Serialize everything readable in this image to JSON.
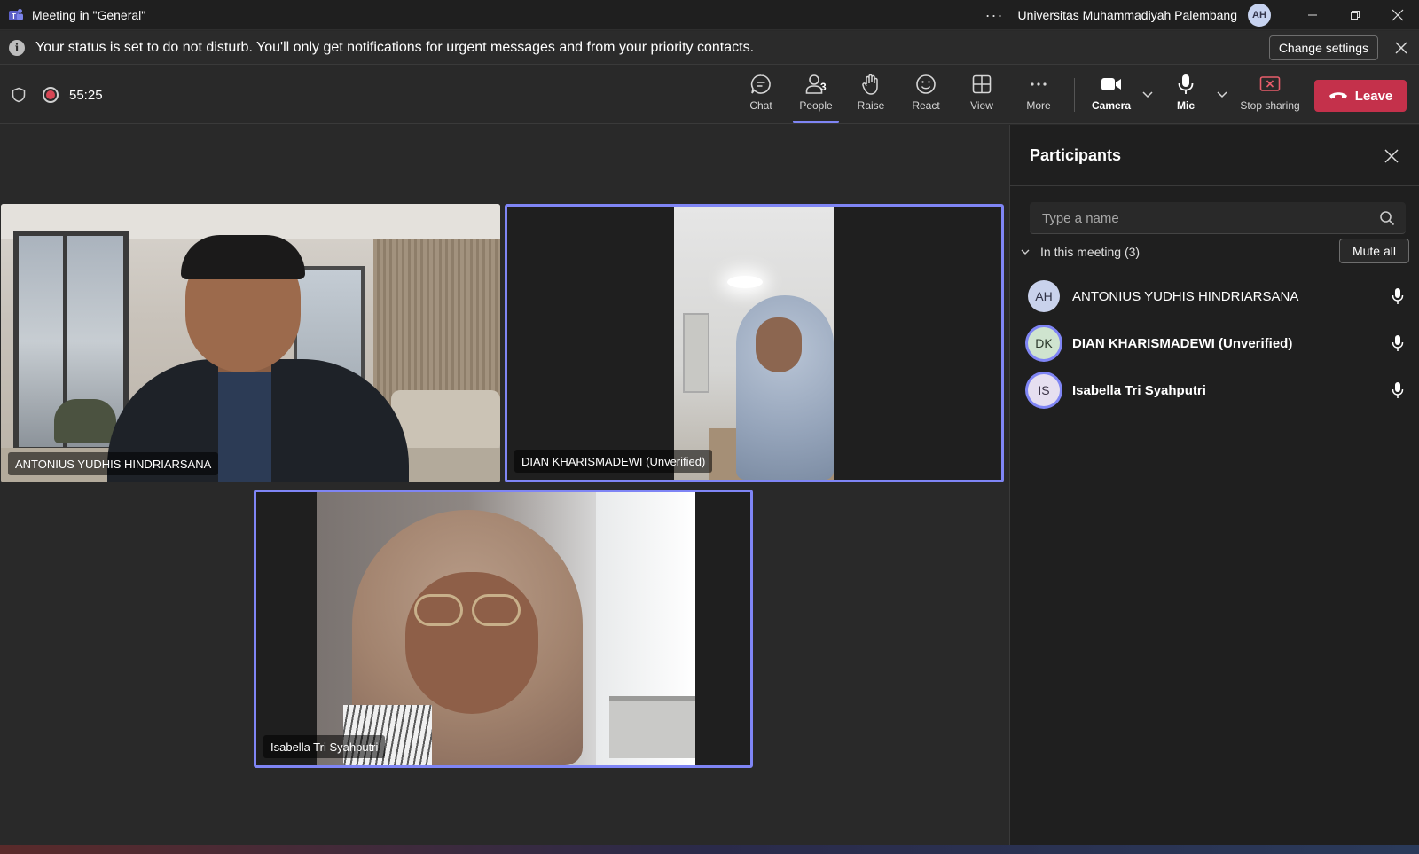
{
  "window": {
    "title": "Meeting in \"General\"",
    "org": "Universitas Muhammadiyah Palembang",
    "user_initials": "AH",
    "more": "···"
  },
  "notice": {
    "text": "Your status is set to do not disturb. You'll only get notifications for urgent messages and from your priority contacts.",
    "button": "Change settings"
  },
  "meeting": {
    "timer": "55:25",
    "recording": true
  },
  "toolbar": {
    "chat": "Chat",
    "people": "People",
    "people_count": "3",
    "raise": "Raise",
    "react": "React",
    "view": "View",
    "more": "More",
    "camera": "Camera",
    "mic": "Mic",
    "stop_sharing": "Stop sharing",
    "leave": "Leave"
  },
  "tiles": [
    {
      "name": "ANTONIUS YUDHIS HINDRIARSANA",
      "speaking": false
    },
    {
      "name": "DIAN KHARISMADEWI (Unverified)",
      "speaking": true
    },
    {
      "name": "Isabella Tri Syahputri",
      "speaking": true
    }
  ],
  "panel": {
    "title": "Participants",
    "search_placeholder": "Type a name",
    "section_label": "In this meeting (3)",
    "mute_all": "Mute all",
    "participants": [
      {
        "initials": "AH",
        "name": "ANTONIUS YUDHIS HINDRIARSANA"
      },
      {
        "initials": "DK",
        "name": "DIAN KHARISMADEWI (Unverified)"
      },
      {
        "initials": "IS",
        "name": "Isabella Tri Syahputri"
      }
    ]
  },
  "colors": {
    "accent": "#7f85f5",
    "leave": "#c4314b",
    "background": "#292929",
    "panel": "#1f1f1f"
  }
}
